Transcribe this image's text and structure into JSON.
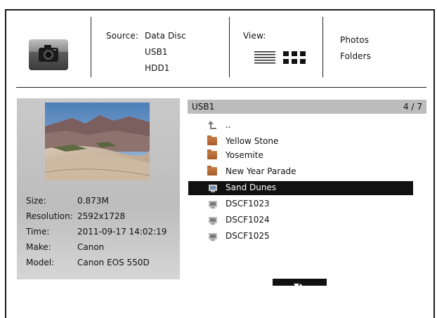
{
  "header": {
    "source_label": "Source:",
    "sources": [
      "Data Disc",
      "USB1",
      "HDD1"
    ],
    "view_label": "View:",
    "view_modes": [
      "Photos",
      "Folders"
    ]
  },
  "info": {
    "rows": [
      {
        "key": "Size:",
        "value": "0.873M"
      },
      {
        "key": "Resolution:",
        "value": "2592x1728"
      },
      {
        "key": "Time:",
        "value": "2011-09-17 14:02:19"
      },
      {
        "key": "Make:",
        "value": "Canon"
      },
      {
        "key": "Model:",
        "value": "Canon EOS 550D"
      }
    ]
  },
  "list": {
    "title": "USB1",
    "counter": "4 / 7",
    "items": [
      {
        "label": "..",
        "icon": "up-arrow-icon"
      },
      {
        "label": "Yellow Stone",
        "icon": "folder-icon"
      },
      {
        "label": "Yosemite",
        "icon": "folder-icon"
      },
      {
        "label": "New Year Parade",
        "icon": "folder-icon"
      },
      {
        "label": "Sand Dunes",
        "icon": "photo-file-icon",
        "selected": true
      },
      {
        "label": "DSCF1023",
        "icon": "photo-file-icon"
      },
      {
        "label": "DSCF1024",
        "icon": "photo-file-icon"
      },
      {
        "label": "DSCF1025",
        "icon": "photo-file-icon"
      }
    ]
  },
  "colors": {
    "selection": "#111111",
    "panel": "#c4c4c4",
    "list_header": "#bcbcbc",
    "folder": "#b86a34"
  }
}
